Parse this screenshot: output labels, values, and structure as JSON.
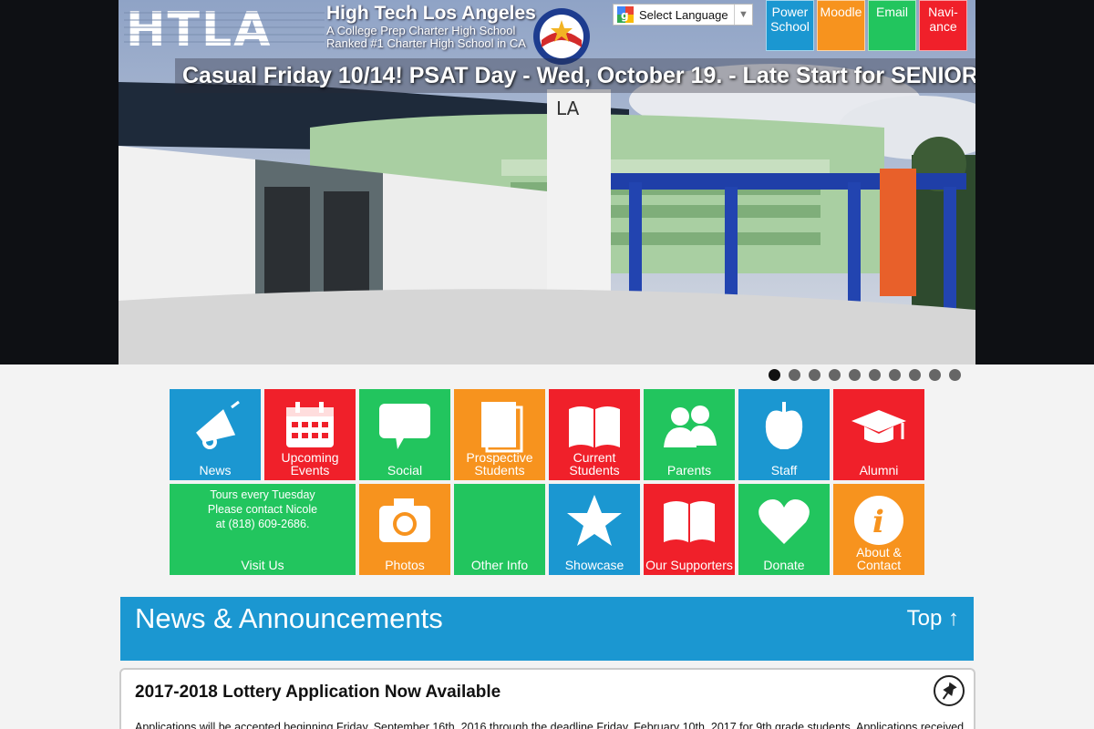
{
  "header": {
    "logo_text": "HTLA",
    "school_name": "High Tech Los Angeles",
    "tagline": "A College Prep Charter High School",
    "ranking": "Ranked #1 Charter High School in CA",
    "seal_text": "California Distinguished School"
  },
  "language_selector": {
    "label": "Select Language",
    "arrow": "▼"
  },
  "top_links": [
    {
      "label": "Power School",
      "color": "#1b97d1"
    },
    {
      "label": "Moodle",
      "color": "#f7931e"
    },
    {
      "label": "Email",
      "color": "#22c55e"
    },
    {
      "label": "Navi-ance",
      "color": "#f0202a"
    }
  ],
  "hero": {
    "headline": "Casual Friday 10/14! PSAT Day - Wed, October 19. - Late Start for SENIORS",
    "building_sign": "LA",
    "slide_count": 10,
    "active_slide": 1
  },
  "tiles": [
    {
      "label": "News",
      "color": "#1b97d1",
      "icon": "megaphone-icon"
    },
    {
      "label": "Upcoming Events",
      "color": "#f0202a",
      "icon": "calendar-icon"
    },
    {
      "label": "Social",
      "color": "#22c55e",
      "icon": "speech-bubble-icon"
    },
    {
      "label": "Prospective Students",
      "color": "#f7931e",
      "icon": "book-icon"
    },
    {
      "label": "Current Students",
      "color": "#f0202a",
      "icon": "open-book-icon"
    },
    {
      "label": "Parents",
      "color": "#22c55e",
      "icon": "people-icon"
    },
    {
      "label": "Staff",
      "color": "#1b97d1",
      "icon": "apple-icon"
    },
    {
      "label": "Alumni",
      "color": "#f0202a",
      "icon": "graduation-cap-icon"
    },
    {
      "label": "Visit Us",
      "color": "#22c55e",
      "icon": "none",
      "note": "Tours every Tuesday Please contact Nicole at (818) 609-2686."
    },
    {
      "label": "Photos",
      "color": "#f7931e",
      "icon": "camera-icon"
    },
    {
      "label": "Other Info",
      "color": "#22c55e",
      "icon": "none"
    },
    {
      "label": "Showcase",
      "color": "#1b97d1",
      "icon": "star-icon"
    },
    {
      "label": "Our Supporters",
      "color": "#f0202a",
      "icon": "open-book-icon"
    },
    {
      "label": "Donate",
      "color": "#22c55e",
      "icon": "heart-icon"
    },
    {
      "label": "About & Contact",
      "color": "#f7931e",
      "icon": "info-icon"
    }
  ],
  "visit_note": {
    "line1": "Tours every Tuesday",
    "line2": "Please contact Nicole",
    "line3": "at (818) 609-2686."
  },
  "news": {
    "title": "News & Announcements",
    "top_link": "Top ↑"
  },
  "announcement": {
    "title": "2017-2018 Lottery Application Now Available",
    "text": "Applications will be accepted beginning Friday, September 16th, 2016 through the deadline Friday, February 10th, 2017 for 9th grade students. Applications received"
  }
}
